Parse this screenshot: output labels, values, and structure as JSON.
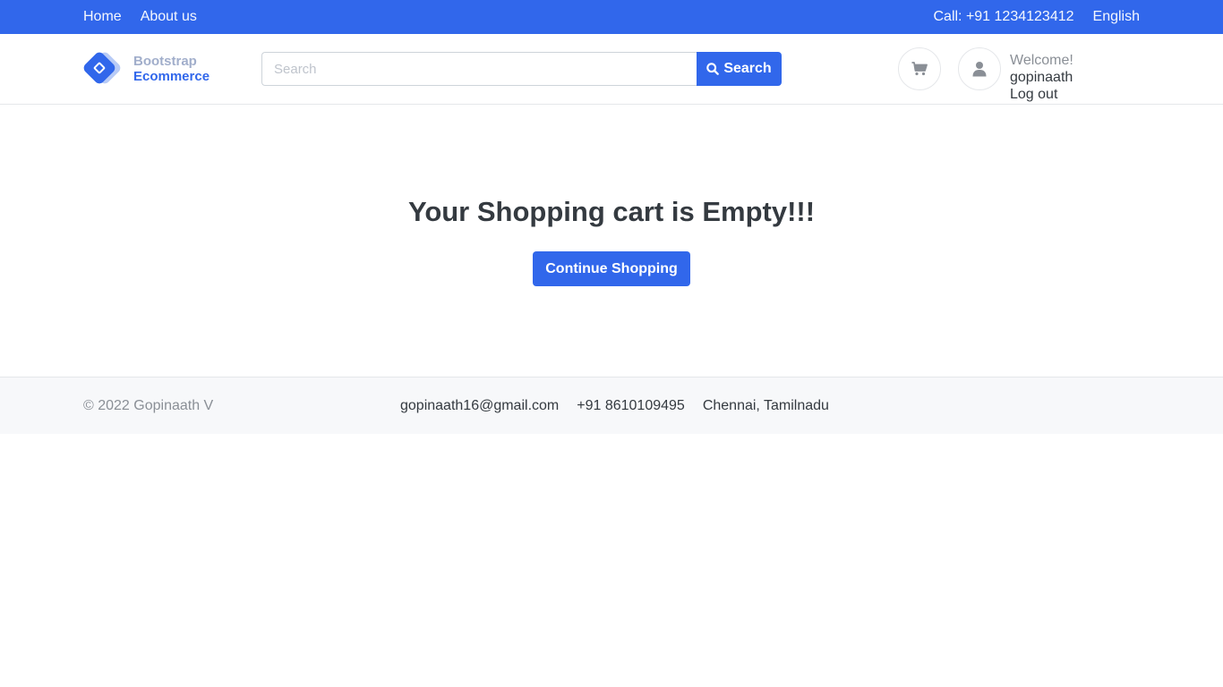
{
  "topbar": {
    "nav": [
      "Home",
      "About us"
    ],
    "phone": "Call: +91 1234123412",
    "language": "English",
    "color": "#3167eb"
  },
  "header": {
    "brand": {
      "line1": "Bootstrap",
      "line2": "Ecommerce",
      "icon": "tag-icon"
    },
    "search": {
      "placeholder": "Search",
      "value": "",
      "button": "Search",
      "icon": "search-icon"
    },
    "cart_icon": "shopping-cart-icon",
    "user_icon": "user-icon",
    "welcome_label": "Welcome!",
    "username": "gopinaath",
    "logout": "Log out"
  },
  "main": {
    "heading": "Your Shopping cart is Empty!!!",
    "cta": "Continue Shopping"
  },
  "footer": {
    "copyright": "© 2022 Gopinaath V",
    "email": "gopinaath16@gmail.com",
    "phone": "+91 8610109495",
    "location": "Chennai, Tamilnadu"
  }
}
